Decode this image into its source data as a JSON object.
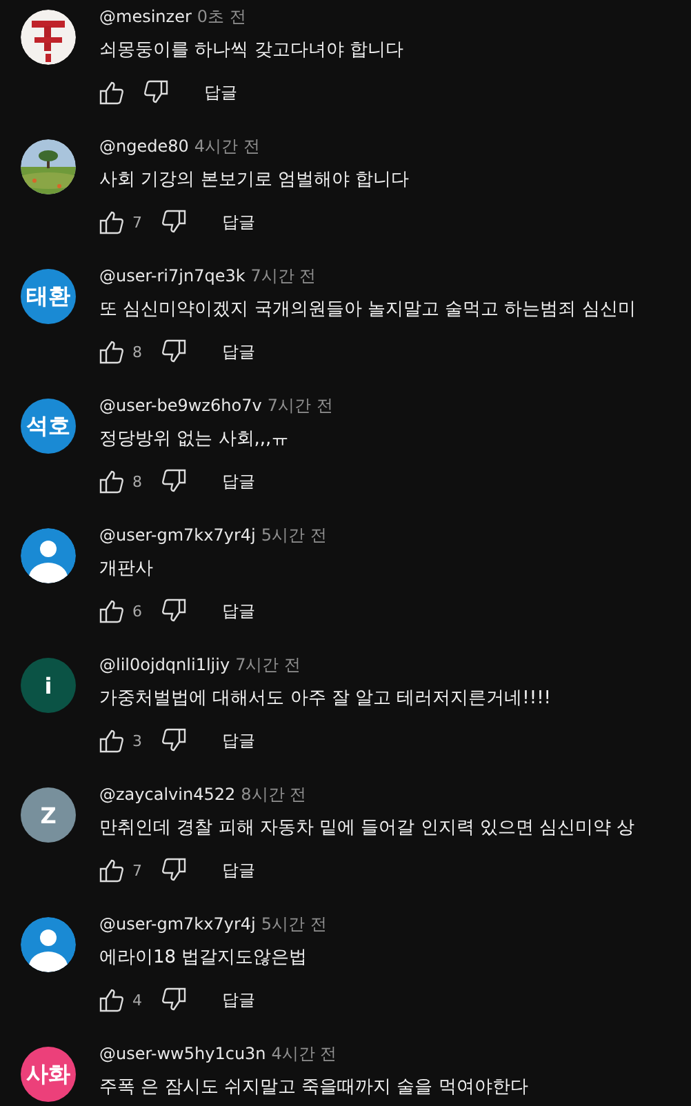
{
  "comments": [
    {
      "author": "@mesinzer",
      "time": "0초 전",
      "text": "쇠몽둥이를 하나씩 갖고다녀야 합니다",
      "reply": "답글"
    },
    {
      "author": "@ngede80",
      "time": "4시간 전",
      "text": "사회 기강의 본보기로 엄벌해야 합니다",
      "likes": "7",
      "reply": "답글"
    },
    {
      "avatar": {
        "kind": "initials",
        "label": "태환",
        "color": "#1a8ad4"
      },
      "author": "@user-ri7jn7qe3k",
      "time": "7시간 전",
      "text": "또 심신미약이겠지 국개의원들아 놀지말고 술먹고 하는범죄 심신미",
      "likes": "8",
      "reply": "답글"
    },
    {
      "avatar": {
        "kind": "initials",
        "label": "석호",
        "color": "#1a8ad4"
      },
      "author": "@user-be9wz6ho7v",
      "time": "7시간 전",
      "text": "정당방위 없는 사회,,,ㅠ",
      "likes": "8",
      "reply": "답글"
    },
    {
      "avatar": {
        "kind": "person",
        "color": "#1a8ad4"
      },
      "author": "@user-gm7kx7yr4j",
      "time": "5시간 전",
      "text": "개판사",
      "likes": "6",
      "reply": "답글"
    },
    {
      "avatar": {
        "kind": "initials",
        "label": "i",
        "color": "#0b5345"
      },
      "author": "@lil0ojdqnli1ljiy",
      "time": "7시간 전",
      "text": "가중처벌법에 대해서도 아주 잘 알고 테러저지른거네!!!!",
      "likes": "3",
      "reply": "답글"
    },
    {
      "avatar": {
        "kind": "initials",
        "label": "Z",
        "color": "#78909c"
      },
      "author": "@zaycalvin4522",
      "time": "8시간 전",
      "text": "만취인데 경찰 피해 자동차 밑에 들어갈 인지력 있으면 심신미약 상",
      "likes": "7",
      "reply": "답글"
    },
    {
      "avatar": {
        "kind": "person",
        "color": "#1a8ad4"
      },
      "author": "@user-gm7kx7yr4j",
      "time": "5시간 전",
      "text": "에라이18 법갈지도않은법",
      "likes": "4",
      "reply": "답글"
    },
    {
      "avatar": {
        "kind": "initials",
        "label": "사화",
        "color": "#ec407a"
      },
      "author": "@user-ww5hy1cu3n",
      "time": "4시간 전",
      "text": "주폭 은 잠시도 쉬지말고 죽을때까지 술을 먹여야한다"
    }
  ]
}
